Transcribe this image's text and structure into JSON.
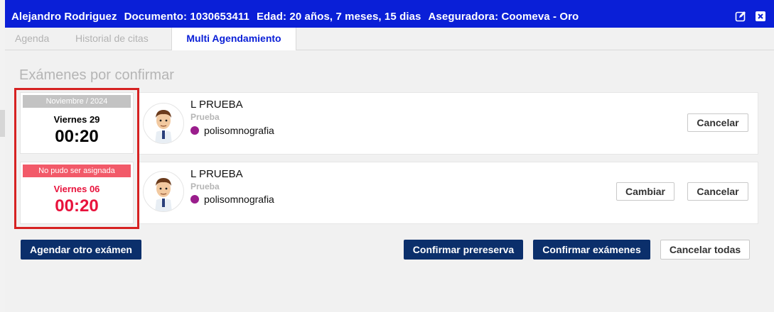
{
  "colors": {
    "header_bg": "#0a1fd7",
    "primary_button": "#0b2f6b",
    "alert_red": "#e8123c",
    "exam_dot": "#9a1d8c"
  },
  "header": {
    "patient": "Alejandro Rodriguez",
    "document": "Documento: 1030653411",
    "age": "Edad: 20 años, 7 meses, 15 dias",
    "insurer": "Aseguradora: Coomeva  - Oro",
    "icons": [
      "edit-icon",
      "close-icon"
    ]
  },
  "tabs": [
    {
      "label": "Agenda"
    },
    {
      "label": "Historial de citas"
    },
    {
      "label": "Multi Agendamiento"
    }
  ],
  "section_title": "Exámenes por confirmar",
  "appointments": [
    {
      "date_header": "Noviembre / 2024",
      "day": "Viernes 29",
      "time": "00:20",
      "doctor": "L PRUEBA",
      "subtitle": "Prueba",
      "exam": "polisomnografia",
      "cancel_label": "Cancelar"
    },
    {
      "date_header": "No pudo ser asignada",
      "day": "Viernes 06",
      "time": "00:20",
      "doctor": "L PRUEBA",
      "subtitle": "Prueba",
      "exam": "polisomnografia",
      "change_label": "Cambiar",
      "cancel_label": "Cancelar"
    }
  ],
  "footer": {
    "schedule_other": "Agendar otro exámen",
    "confirm_prereserve": "Confirmar prereserva",
    "confirm_exams": "Confirmar exámenes",
    "cancel_all": "Cancelar todas"
  }
}
